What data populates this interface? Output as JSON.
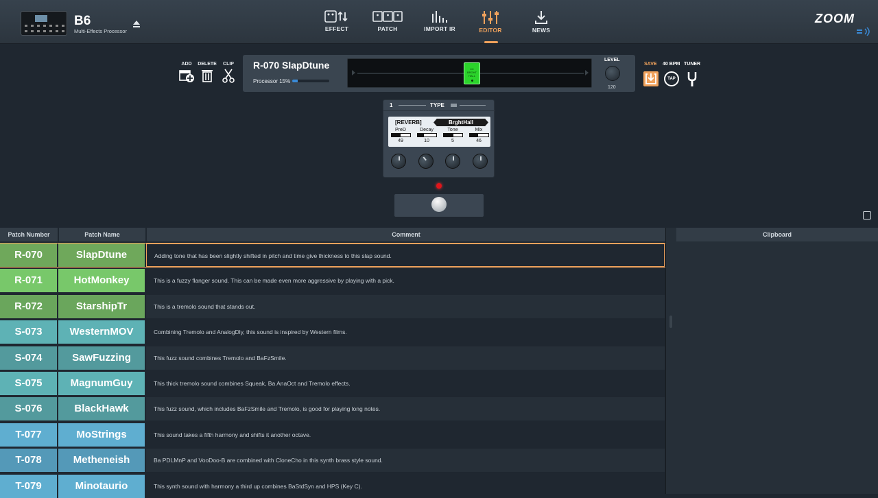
{
  "device": {
    "model": "B6",
    "subtitle": "Multi-Effects Processor"
  },
  "nav": [
    {
      "label": "EFFECT",
      "icon": "effect-icon"
    },
    {
      "label": "PATCH",
      "icon": "patch-icon"
    },
    {
      "label": "IMPORT IR",
      "icon": "import-ir-icon"
    },
    {
      "label": "EDITOR",
      "icon": "editor-icon",
      "active": true
    },
    {
      "label": "NEWS",
      "icon": "news-icon"
    }
  ],
  "brand": "ZOOM",
  "tools": {
    "add": "ADD",
    "delete": "DELETE",
    "clip": "CLIP"
  },
  "patch": {
    "title": "R-070  SlapDtune",
    "processor_label": "Processor 15%",
    "processor_fraction": 0.15,
    "level_label": "LEVEL",
    "level_value": "120"
  },
  "right_tools": {
    "save": "SAVE",
    "bpm": "40 BPM",
    "tap": "TAP",
    "tuner": "TUNER"
  },
  "effect_unit": {
    "slot": "1",
    "type_label": "TYPE",
    "category": "[REVERB]",
    "name": "BrghtHall",
    "params": [
      {
        "label": "PreD",
        "value": "49",
        "fraction": 0.49
      },
      {
        "label": "Decay",
        "value": "10",
        "fraction": 0.35
      },
      {
        "label": "Tone",
        "value": "5",
        "fraction": 0.55
      },
      {
        "label": "Mix",
        "value": "46",
        "fraction": 0.46
      }
    ]
  },
  "table": {
    "headers": {
      "number": "Patch Number",
      "name": "Patch Name",
      "comment": "Comment"
    },
    "rows": [
      {
        "number": "R-070",
        "name": "SlapDtune",
        "comment": "Adding tone that has been slightly shifted in pitch and time give thickness to this slap sound.",
        "color": "#6fa85b",
        "selected": true
      },
      {
        "number": "R-071",
        "name": "HotMonkey",
        "comment": "This is a fuzzy flanger sound. This can be made even more aggressive by playing with a pick.",
        "color": "#78c86a"
      },
      {
        "number": "R-072",
        "name": "StarshipTr",
        "comment": "This is a tremolo sound that stands out.",
        "color": "#6aa65c"
      },
      {
        "number": "S-073",
        "name": "WesternMOV",
        "comment": "Combining Tremolo and AnalogDly, this sound is inspired by Western films.",
        "color": "#5eb2b5"
      },
      {
        "number": "S-074",
        "name": "SawFuzzing",
        "comment": "This fuzz sound combines Tremolo and BaFzSmile.",
        "color": "#539a9d"
      },
      {
        "number": "S-075",
        "name": "MagnumGuy",
        "comment": "This thick tremolo sound combines Squeak, Ba AnaOct and Tremolo effects.",
        "color": "#5eb2b5"
      },
      {
        "number": "S-076",
        "name": "BlackHawk",
        "comment": "This fuzz sound, which includes BaFzSmile and Tremolo, is good for playing long notes.",
        "color": "#539a9d"
      },
      {
        "number": "T-077",
        "name": "MoStrings",
        "comment": "This sound takes a fifth harmony and shifts it another octave.",
        "color": "#5faed0"
      },
      {
        "number": "T-078",
        "name": "Metheneish",
        "comment": "Ba PDLMnP and VooDoo-B are combined with CloneCho in this synth brass style sound.",
        "color": "#5499b8"
      },
      {
        "number": "T-079",
        "name": "Minotaurio",
        "comment": "This synth sound with harmony a third up combines BaStdSyn and HPS (Key C).",
        "color": "#5faed0"
      }
    ]
  },
  "clipboard": {
    "title": "Clipboard"
  }
}
